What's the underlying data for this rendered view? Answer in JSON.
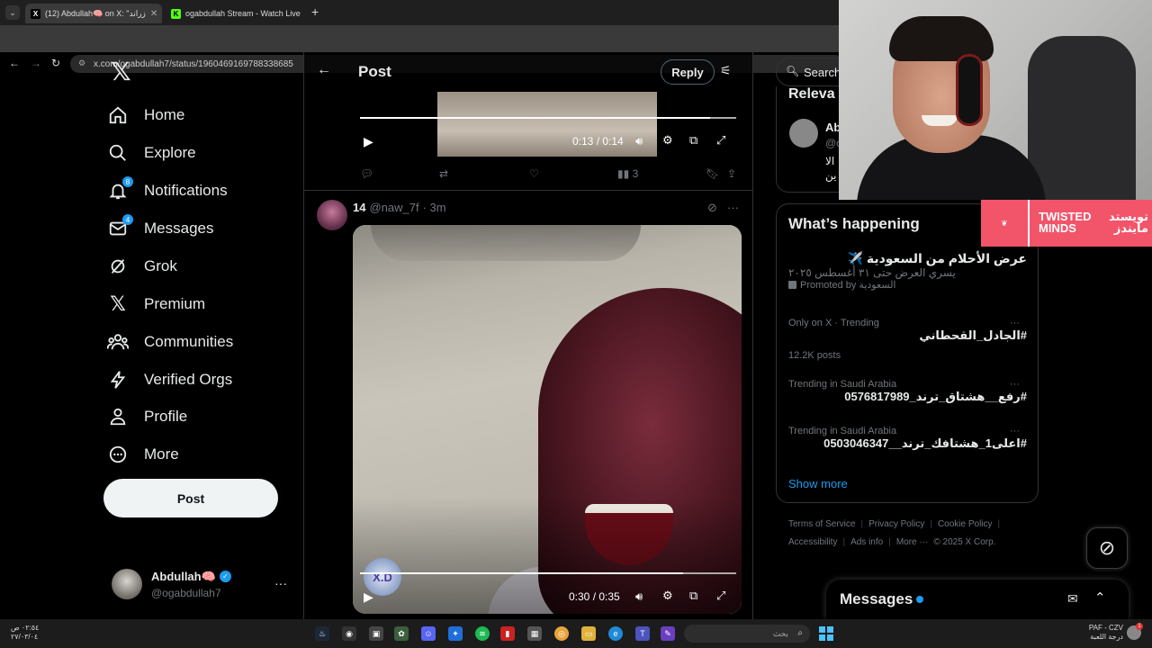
{
  "browser": {
    "tabs": [
      {
        "title": "(12) Abdullah🧠 on X: \"زراند"
      },
      {
        "title": "ogabdullah Stream - Watch Live"
      }
    ],
    "url": "x.com/ogabdullah7/status/1960469169788338685"
  },
  "sidebar": {
    "items": [
      {
        "label": "Home",
        "icon": "home-icon"
      },
      {
        "label": "Explore",
        "icon": "search-icon"
      },
      {
        "label": "Notifications",
        "icon": "bell-icon",
        "badge": "8"
      },
      {
        "label": "Messages",
        "icon": "mail-icon",
        "badge": "4"
      },
      {
        "label": "Grok",
        "icon": "grok-icon"
      },
      {
        "label": "Premium",
        "icon": "x-logo-icon"
      },
      {
        "label": "Communities",
        "icon": "people-icon"
      },
      {
        "label": "Verified Orgs",
        "icon": "lightning-icon"
      },
      {
        "label": "Profile",
        "icon": "person-icon"
      },
      {
        "label": "More",
        "icon": "more-circle-icon"
      }
    ],
    "post_label": "Post",
    "account": {
      "name": "Abdullah🧠",
      "handle": "@ogabdullah7"
    }
  },
  "main": {
    "header_title": "Post",
    "reply_label": "Reply",
    "video1": {
      "time": "0:13 / 0:14",
      "progress": 0.93
    },
    "tweet1_actions": {
      "views": "3"
    },
    "tweet2": {
      "name": "14",
      "handle": "@naw_7f",
      "time": "· 3m"
    },
    "video2": {
      "time": "0:30 / 0:35",
      "progress": 0.86,
      "watermark": "X.D"
    }
  },
  "right": {
    "search_placeholder": "Search",
    "relevant_title": "Releva",
    "relevant": {
      "name": "Ab",
      "handle": "@c",
      "bio1": "الا",
      "bio2": "ين"
    },
    "whats_happening": "What’s happening",
    "promo": {
      "title": "عرض الأحلام من السعودية ✈️",
      "subtitle": "يسري العرض حتى ٣١ أغسطس ٢٠٢٥",
      "promoted_by": "Promoted by السعودية"
    },
    "trends": [
      {
        "meta": "Only on X · Trending",
        "title": "#الجادل_القحطاني",
        "sub": "12.2K posts"
      },
      {
        "meta": "Trending in Saudi Arabia",
        "title": "#رفع__هشتاق_ترند_0576817989",
        "sub": ""
      },
      {
        "meta": "Trending in Saudi Arabia",
        "title": "#اعلى1_هشتافك_ترند__0503046347",
        "sub": ""
      }
    ],
    "show_more": "Show more",
    "footer_row1": [
      "Terms of Service",
      "Privacy Policy",
      "Cookie Policy"
    ],
    "footer_row2": [
      "Accessibility",
      "Ads info",
      "More ···",
      "© 2025 X Corp."
    ],
    "messages_dock": "Messages"
  },
  "overlay": {
    "brand_en_1": "TWISTED",
    "brand_en_2": "MINDS",
    "brand_ar_1": "تويستد",
    "brand_ar_2": "مايندز"
  },
  "taskbar": {
    "time_left_1": "٠٢:٥٤ ص",
    "time_left_2": "٢٧/٠٣/٠٤",
    "search_text": "بحث",
    "right_1": "PAF - CZV",
    "right_2": "درجة اللعبة",
    "notify": "1"
  }
}
